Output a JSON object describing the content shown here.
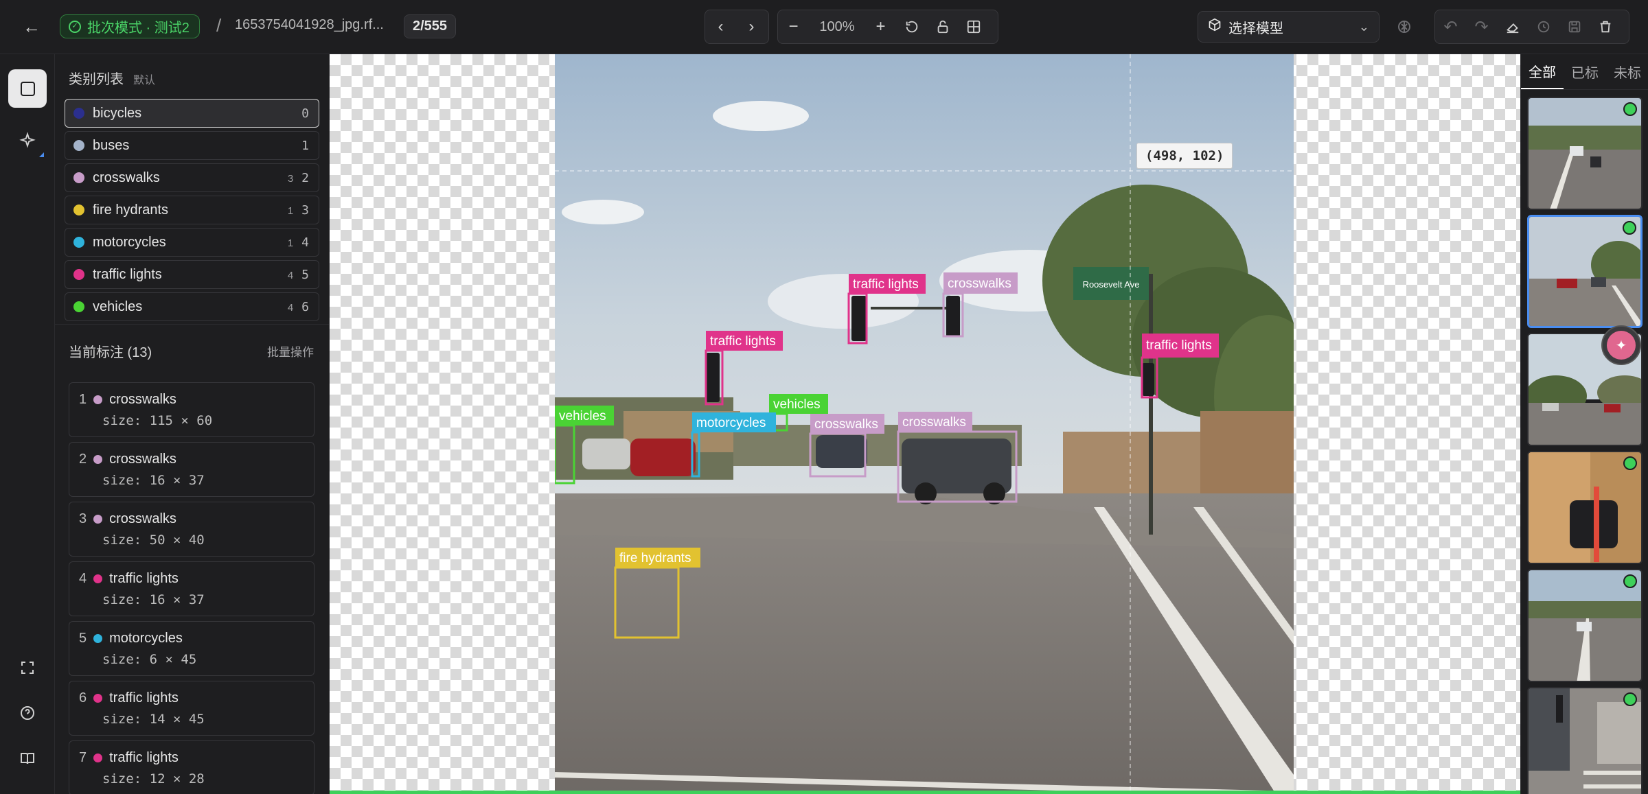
{
  "header": {
    "mode_label": "批次模式 · 测试2",
    "separator": "/",
    "filename": "1653754041928_jpg.rf...",
    "counter": "2/555",
    "zoom": "100%",
    "model_placeholder": "选择模型"
  },
  "categories": {
    "title": "类别列表",
    "subtitle": "默认",
    "items": [
      {
        "name": "bicycles",
        "count": "",
        "key": "0",
        "color": "#2b2f8e"
      },
      {
        "name": "buses",
        "count": "",
        "key": "1",
        "color": "#a4b3c9"
      },
      {
        "name": "crosswalks",
        "count": "3",
        "key": "2",
        "color": "#c79cc8"
      },
      {
        "name": "fire hydrants",
        "count": "1",
        "key": "3",
        "color": "#e2c230"
      },
      {
        "name": "motorcycles",
        "count": "1",
        "key": "4",
        "color": "#2fb3dc"
      },
      {
        "name": "traffic lights",
        "count": "4",
        "key": "5",
        "color": "#e0338a"
      },
      {
        "name": "vehicles",
        "count": "4",
        "key": "6",
        "color": "#4ad334"
      }
    ]
  },
  "annotations": {
    "title": "当前标注 (13)",
    "batch_label": "批量操作",
    "items": [
      {
        "index": "1",
        "label": "crosswalks",
        "size": "size: 115 × 60",
        "color": "#c79cc8"
      },
      {
        "index": "2",
        "label": "crosswalks",
        "size": "size: 16 × 37",
        "color": "#c79cc8"
      },
      {
        "index": "3",
        "label": "crosswalks",
        "size": "size: 50 × 40",
        "color": "#c79cc8"
      },
      {
        "index": "4",
        "label": "traffic lights",
        "size": "size: 16 × 37",
        "color": "#e0338a"
      },
      {
        "index": "5",
        "label": "motorcycles",
        "size": "size: 6 × 45",
        "color": "#2fb3dc"
      },
      {
        "index": "6",
        "label": "traffic lights",
        "size": "size: 14 × 45",
        "color": "#e0338a"
      },
      {
        "index": "7",
        "label": "traffic lights",
        "size": "size: 12 × 28",
        "color": "#e0338a"
      }
    ]
  },
  "canvas": {
    "coordinate_readout": "(498, 102)",
    "box_labels": {
      "traffic_lights": "traffic lights",
      "crosswalks": "crosswalks",
      "vehicles": "vehicles",
      "motorcycles": "motorcycles",
      "fire_hydrants": "fire hydrants"
    },
    "sign_text": "Roosevelt Ave"
  },
  "right_panel": {
    "tabs": [
      "全部",
      "已标",
      "未标"
    ]
  }
}
